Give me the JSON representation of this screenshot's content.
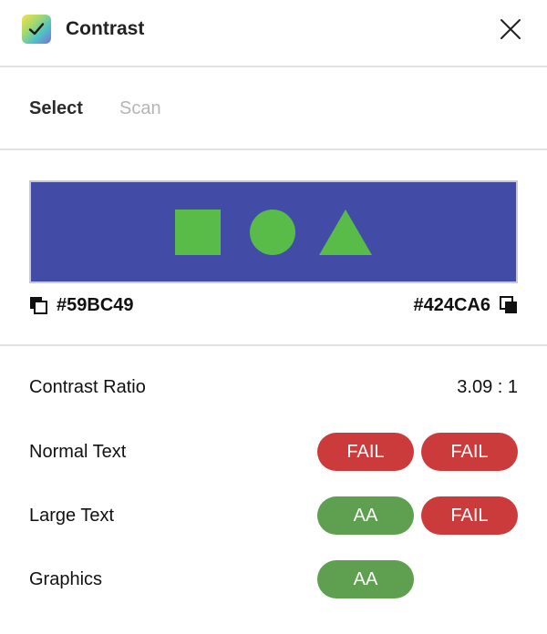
{
  "app": {
    "title": "Contrast",
    "icon": "checkmark-icon",
    "close_icon": "close-icon"
  },
  "tabs": [
    {
      "label": "Select",
      "active": true
    },
    {
      "label": "Scan",
      "active": false
    }
  ],
  "preview": {
    "background": "#424CA6",
    "foreground": "#59BC49",
    "shapes": [
      "square",
      "circle",
      "triangle"
    ]
  },
  "colors": {
    "foreground_hex": "#59BC49",
    "background_hex": "#424CA6"
  },
  "results": {
    "contrast_ratio_label": "Contrast Ratio",
    "contrast_ratio_value": "3.09 : 1",
    "normal_text": {
      "label": "Normal Text",
      "aa": "FAIL",
      "aaa": "FAIL"
    },
    "large_text": {
      "label": "Large Text",
      "aa": "AA",
      "aaa": "FAIL"
    },
    "graphics": {
      "label": "Graphics",
      "aa": "AA"
    }
  },
  "status_colors": {
    "pass": "#5EA04F",
    "fail": "#CC3B3B"
  }
}
